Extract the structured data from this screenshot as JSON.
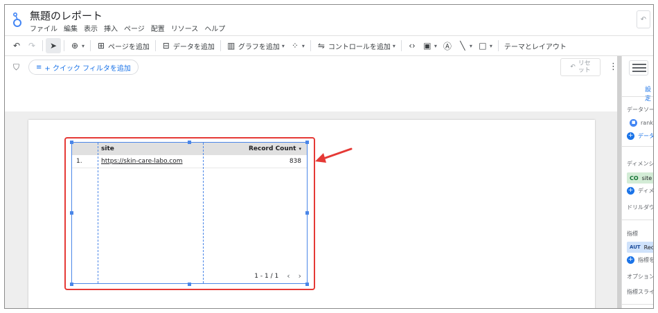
{
  "header": {
    "title": "無題のレポート",
    "menu": [
      "ファイル",
      "編集",
      "表示",
      "挿入",
      "ページ",
      "配置",
      "リソース",
      "ヘルプ"
    ]
  },
  "toolbar": {
    "add_page": "ページを追加",
    "add_data": "データを追加",
    "add_chart": "グラフを追加",
    "add_control": "コントロールを追加",
    "theme_layout": "テーマとレイアウト"
  },
  "filter": {
    "quick_filter": "+ クイック フィルタを追加",
    "reset_line1": "リセ",
    "reset_line2": "ット"
  },
  "table": {
    "columns": [
      "site",
      "Record Count"
    ],
    "rows": [
      {
        "index": "1.",
        "site": "https://skin-care-labo.com",
        "record_count": "838"
      }
    ],
    "pagination": "1 - 1 / 1"
  },
  "panel": {
    "tab": "設定",
    "data_source_label": "データソース",
    "data_source_value": "rank",
    "add_data_label": "データ",
    "dimension_label": "ディメンショ",
    "dimension_badge": "CO",
    "dimension_value": "site",
    "add_dimension_label": "ディメ",
    "drilldown_label": "ドリルダウン",
    "metric_label": "指標",
    "metric_badge": "AUT",
    "metric_value": "Record",
    "add_metric_label": "指標を",
    "optional_label": "オプションの",
    "slider_label": "指標スライダ"
  },
  "colors": {
    "accent": "#1a73e8",
    "selection": "#4a86e8",
    "annotation": "#e53935"
  }
}
